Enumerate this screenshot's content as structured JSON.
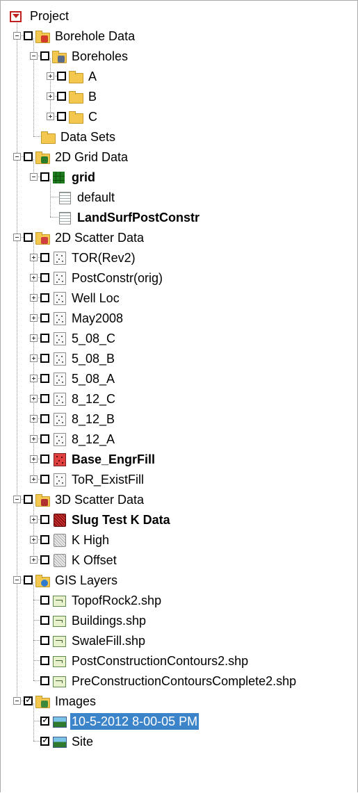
{
  "tree": {
    "root": {
      "label": "Project",
      "icon": "project-icon"
    },
    "borehole_data": {
      "label": "Borehole Data",
      "icon": "borehole-folder-icon",
      "boreholes": {
        "label": "Boreholes",
        "icon": "boreholes-folder-icon",
        "children": [
          {
            "label": "A"
          },
          {
            "label": "B"
          },
          {
            "label": "C"
          }
        ]
      },
      "data_sets": {
        "label": "Data Sets",
        "icon": "folder-icon"
      }
    },
    "grid_data_2d": {
      "label": "2D Grid Data",
      "icon": "grid-folder-icon",
      "grid": {
        "label": "grid",
        "icon": "grid-icon",
        "children": [
          {
            "label": "default",
            "icon": "dataset-icon"
          },
          {
            "label": "LandSurfPostConstr",
            "icon": "dataset-icon",
            "active": true
          }
        ]
      }
    },
    "scatter_data_2d": {
      "label": "2D Scatter Data",
      "icon": "scatter-folder-icon",
      "children": [
        {
          "label": "TOR(Rev2)"
        },
        {
          "label": "PostConstr(orig)"
        },
        {
          "label": "Well Loc"
        },
        {
          "label": "May2008"
        },
        {
          "label": "5_08_C"
        },
        {
          "label": "5_08_B"
        },
        {
          "label": "5_08_A"
        },
        {
          "label": "8_12_C"
        },
        {
          "label": "8_12_B"
        },
        {
          "label": "8_12_A"
        },
        {
          "label": "Base_EngrFill",
          "active": true
        },
        {
          "label": "ToR_ExistFill"
        }
      ]
    },
    "scatter_data_3d": {
      "label": "3D Scatter Data",
      "icon": "scatter3d-folder-icon",
      "children": [
        {
          "label": "Slug Test K Data",
          "active": true
        },
        {
          "label": "K High"
        },
        {
          "label": "K Offset"
        }
      ]
    },
    "gis_layers": {
      "label": "GIS Layers",
      "icon": "gis-folder-icon",
      "children": [
        {
          "label": "TopofRock2.shp"
        },
        {
          "label": "Buildings.shp"
        },
        {
          "label": "SwaleFill.shp"
        },
        {
          "label": "PostConstructionContours2.shp"
        },
        {
          "label": "PreConstructionContoursComplete2.shp"
        }
      ]
    },
    "images": {
      "label": "Images",
      "icon": "images-folder-icon",
      "checked": true,
      "children": [
        {
          "label": "10-5-2012 8-00-05 PM",
          "checked": true,
          "selected": true
        },
        {
          "label": "Site",
          "checked": true
        }
      ]
    }
  },
  "colors": {
    "selection": "#3b84c9",
    "tree_lines": "#8a8a8a"
  }
}
